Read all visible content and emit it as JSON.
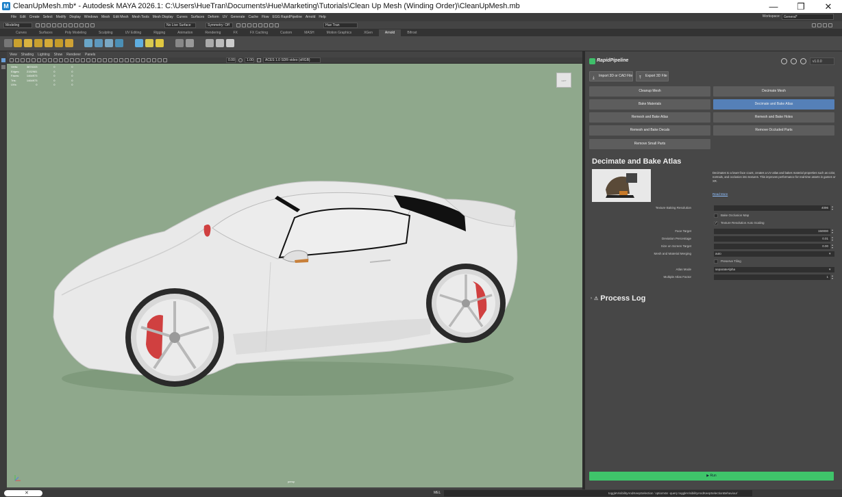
{
  "window": {
    "title": "CleanUpMesh.mb* - Autodesk MAYA 2026.1: C:\\Users\\HueTran\\Documents\\Hue\\Marketing\\Tutorials\\Clean Up Mesh (Winding Order)\\CleanUpMesh.mb",
    "app_icon": "maya-logo-icon",
    "controls": [
      "minimize",
      "maximize",
      "close"
    ]
  },
  "menubar": {
    "items": [
      "File",
      "Edit",
      "Create",
      "Select",
      "Modify",
      "Display",
      "Windows",
      "Mesh",
      "Edit Mesh",
      "Mesh Tools",
      "Mesh Display",
      "Curves",
      "Surfaces",
      "Deform",
      "UV",
      "Generate",
      "Cache",
      "Flow",
      "EGG RapidPipeline",
      "Arnold",
      "Help"
    ],
    "workspace_label": "Workspace:",
    "workspace_value": "General*"
  },
  "statusline": {
    "mode": "Modeling",
    "live_surface": "No Live Surface",
    "symmetry": "Symmetry: Off",
    "user": "Hue Tran"
  },
  "shelf": {
    "tabs": [
      "Curves",
      "Surfaces",
      "Poly Modeling",
      "Sculpting",
      "UV Editing",
      "Rigging",
      "Animation",
      "Rendering",
      "FX",
      "FX Caching",
      "Custom",
      "MASH",
      "Motion Graphics",
      "XGen",
      "Arnold",
      "Bifrost"
    ],
    "active_tab": "Arnold"
  },
  "viewport": {
    "menu": [
      "View",
      "Shading",
      "Lighting",
      "Show",
      "Renderer",
      "Panels"
    ],
    "exposure": "0.00",
    "gamma": "1.00",
    "color_space": "ACES 1.0 SDR-video (sRGB)",
    "camera_label": "persp",
    "viewcube_label": "LEFT",
    "hud": [
      {
        "label": "Verts:",
        "a": "3874103",
        "b": "0",
        "c": "0"
      },
      {
        "label": "Edges:",
        "a": "2152981",
        "b": "0",
        "c": "0"
      },
      {
        "label": "Faces:",
        "a": "1464973",
        "b": "0",
        "c": "0"
      },
      {
        "label": "Tris:",
        "a": "1464973",
        "b": "0",
        "c": "0"
      },
      {
        "label": "UVs:",
        "a": "0",
        "b": "0",
        "c": "0"
      }
    ]
  },
  "panel": {
    "brand": "RapidPipeline",
    "version": "v1.0.0",
    "import_cad": "Import 3D or CAD File",
    "export": "Export 3D File",
    "actions": [
      "Cleanup Mesh",
      "Decimate Mesh",
      "Bake Materials",
      "Decimate and Bake Atlas",
      "Remesh and Bake Atlas",
      "Remesh and Bake Holes",
      "Remesh and Bake Decals",
      "Remove Occluded Parts",
      "Remove Small Parts"
    ],
    "selected_action": "Decimate and Bake Atlas",
    "section_title": "Decimate and Bake Atlas",
    "description": "Decimates to a lower face count, creates a UV atlas and bakes material properties such as color, normals, and occlusion into textures. This improves performance for real-time assets in games or XR.",
    "read_more": "Read More",
    "params": {
      "texture_baking_resolution": {
        "label": "Texture Baking Resolution",
        "value": "4096"
      },
      "bake_occlusion_map": {
        "label": "Bake Occlusion Map",
        "checked": false
      },
      "texture_resolution_auto_scaling": {
        "label": "Texture Resolution Auto Scaling",
        "checked": true
      },
      "face_target": {
        "label": "Face Target",
        "value": "150000"
      },
      "deviation_percentage": {
        "label": "Deviation Percentage",
        "value": "0.01"
      },
      "size_on_screen_target": {
        "label": "Size on Screen Target",
        "value": "0.00"
      },
      "mesh_material_merging": {
        "label": "Mesh and Material Merging",
        "value": "auto"
      },
      "preserve_tiling": {
        "label": "Preserve Tiling",
        "checked": false
      },
      "atlas_mode": {
        "label": "Atlas Mode",
        "value": "separateAlpha"
      },
      "multiple_atlas_factor": {
        "label": "Multiple Atlas Factor",
        "value": "1"
      }
    },
    "process_log": "Process Log",
    "run": "Run"
  },
  "bottom": {
    "mel_label": "MEL",
    "mel_output": "toggleVisibilityAndKeepSelection `optionVar -query toggleVisibilityAndKeepSelectionBehaviour`"
  },
  "colors": {
    "viewport_bg": "#8fa88c",
    "selected_action": "#5580b8",
    "run_button": "#3fc46a",
    "car_body": "#e9e9e9",
    "brake_caliper": "#d04040"
  }
}
